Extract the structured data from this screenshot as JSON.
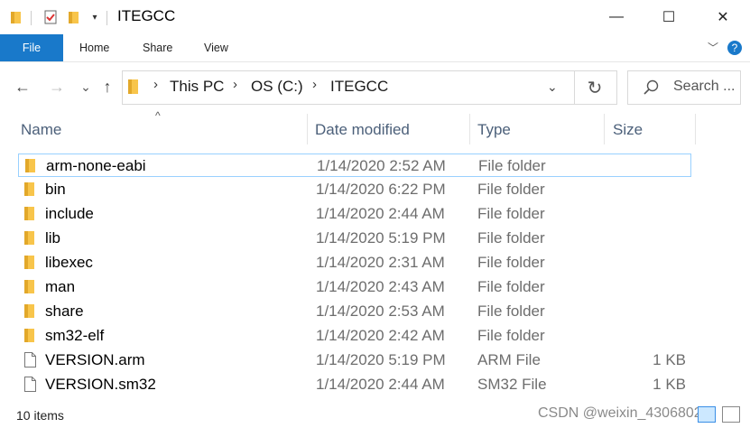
{
  "titlebar": {
    "title": "ITEGCC",
    "controls": {
      "minimize": "—",
      "maximize": "☐",
      "close": "✕"
    }
  },
  "ribbon": {
    "tabs": [
      "File",
      "Home",
      "Share",
      "View"
    ],
    "collapse_glyph": "﹀",
    "help_glyph": "?"
  },
  "navigation": {
    "back_glyph": "←",
    "forward_glyph": "→",
    "recent_glyph": "⌄",
    "up_glyph": "↑",
    "breadcrumbs": [
      "This PC",
      "OS (C:)",
      "ITEGCC"
    ],
    "search_placeholder": "Search ...",
    "refresh_glyph": "↻"
  },
  "columns": {
    "name": "Name",
    "date": "Date modified",
    "type": "Type",
    "size": "Size",
    "sort_indicator": "^"
  },
  "files": [
    {
      "name": "arm-none-eabi",
      "date": "1/14/2020 2:52 AM",
      "type": "File folder",
      "size": "",
      "kind": "folder",
      "selected": true
    },
    {
      "name": "bin",
      "date": "1/14/2020 6:22 PM",
      "type": "File folder",
      "size": "",
      "kind": "folder"
    },
    {
      "name": "include",
      "date": "1/14/2020 2:44 AM",
      "type": "File folder",
      "size": "",
      "kind": "folder"
    },
    {
      "name": "lib",
      "date": "1/14/2020 5:19 PM",
      "type": "File folder",
      "size": "",
      "kind": "folder"
    },
    {
      "name": "libexec",
      "date": "1/14/2020 2:31 AM",
      "type": "File folder",
      "size": "",
      "kind": "folder"
    },
    {
      "name": "man",
      "date": "1/14/2020 2:43 AM",
      "type": "File folder",
      "size": "",
      "kind": "folder"
    },
    {
      "name": "share",
      "date": "1/14/2020 2:53 AM",
      "type": "File folder",
      "size": "",
      "kind": "folder"
    },
    {
      "name": "sm32-elf",
      "date": "1/14/2020 2:42 AM",
      "type": "File folder",
      "size": "",
      "kind": "folder"
    },
    {
      "name": "VERSION.arm",
      "date": "1/14/2020 5:19 PM",
      "type": "ARM File",
      "size": "1 KB",
      "kind": "file"
    },
    {
      "name": "VERSION.sm32",
      "date": "1/14/2020 2:44 AM",
      "type": "SM32 File",
      "size": "1 KB",
      "kind": "file"
    }
  ],
  "status": {
    "item_count": "10 items",
    "watermark": "CSDN @weixin_43068025"
  },
  "colors": {
    "accent": "#1979ca",
    "folder": "#f8c54b",
    "selection_border": "#99d1ff",
    "header_text": "#4c607a"
  }
}
